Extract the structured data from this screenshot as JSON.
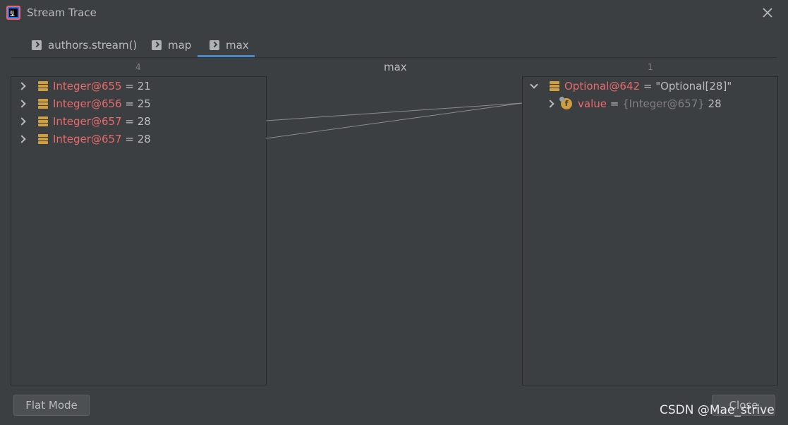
{
  "window": {
    "title": "Stream Trace",
    "app_icon": "intellij-idea-icon",
    "close_icon": "close-icon"
  },
  "tabs": [
    {
      "label": "authors.stream()",
      "active": false
    },
    {
      "label": "map",
      "active": false
    },
    {
      "label": "max",
      "active": true
    }
  ],
  "left_panel": {
    "count": "4",
    "items": [
      {
        "name": "Integer@655",
        "eq": "=",
        "value": "21"
      },
      {
        "name": "Integer@656",
        "eq": "=",
        "value": "25"
      },
      {
        "name": "Integer@657",
        "eq": "=",
        "value": "28"
      },
      {
        "name": "Integer@657",
        "eq": "=",
        "value": "28"
      }
    ]
  },
  "operation": {
    "label": "max"
  },
  "right_panel": {
    "count": "1",
    "result": {
      "name": "Optional@642",
      "eq": "=",
      "value": "\"Optional[28]\""
    },
    "field": {
      "name": "value",
      "eq": "=",
      "ref": "{Integer@657}",
      "value": "28"
    }
  },
  "buttons": {
    "flat_mode": "Flat Mode",
    "close": "Close"
  },
  "watermark": "CSDN @Mae_strive",
  "colors": {
    "background": "#3c3f41",
    "variable": "#e8696b",
    "accent": "#4a88c7",
    "icon": "#d0a040"
  }
}
